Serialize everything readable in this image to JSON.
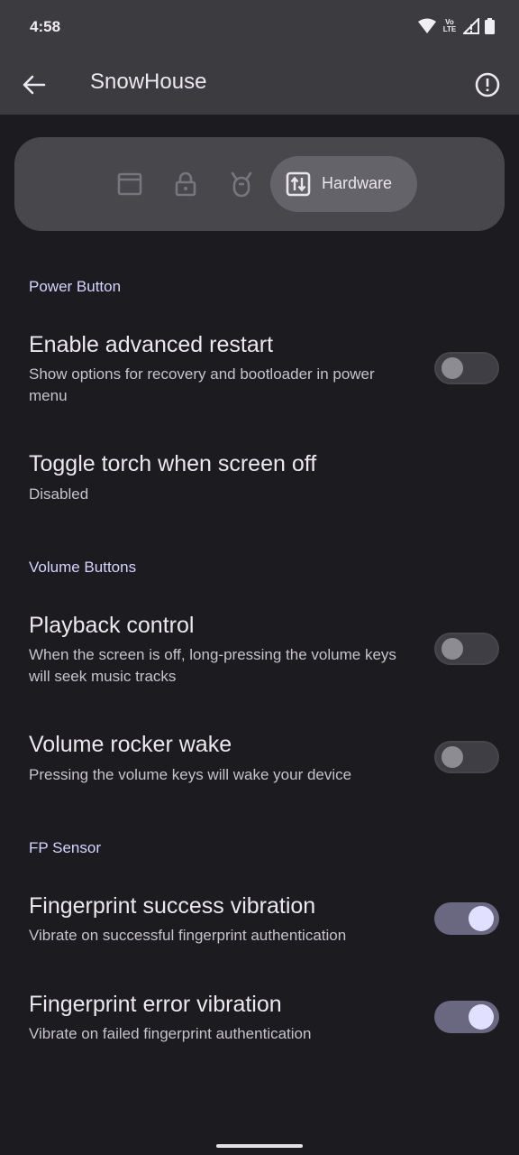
{
  "status": {
    "time": "4:58",
    "network_label": "VoLTE"
  },
  "appbar": {
    "title": "SnowHouse"
  },
  "tabs": {
    "items": [
      {
        "icon": "window-icon"
      },
      {
        "icon": "lock-icon"
      },
      {
        "icon": "bug-icon"
      },
      {
        "icon": "hardware-swap-icon",
        "label": "Hardware",
        "active": true
      }
    ]
  },
  "sections": [
    {
      "header": "Power Button",
      "items": [
        {
          "title": "Enable advanced restart",
          "subtitle": "Show options for recovery and bootloader in power menu",
          "toggle": false
        },
        {
          "title": "Toggle torch when screen off",
          "subtitle": "Disabled"
        }
      ]
    },
    {
      "header": "Volume Buttons",
      "items": [
        {
          "title": "Playback control",
          "subtitle": "When the screen is off, long-pressing the volume keys will seek music tracks",
          "toggle": false
        },
        {
          "title": "Volume rocker wake",
          "subtitle": "Pressing the volume keys will wake your device",
          "toggle": false
        }
      ]
    },
    {
      "header": "FP Sensor",
      "items": [
        {
          "title": "Fingerprint success vibration",
          "subtitle": "Vibrate on successful fingerprint authentication",
          "toggle": true
        },
        {
          "title": "Fingerprint error vibration",
          "subtitle": "Vibrate on failed fingerprint authentication",
          "toggle": true
        }
      ]
    }
  ],
  "colors": {
    "background": "#1c1b20",
    "appbar": "#3c3b40",
    "accent": "#d6d4ff",
    "switch_on_track": "#6a6781",
    "switch_on_thumb": "#e2e0ff"
  }
}
